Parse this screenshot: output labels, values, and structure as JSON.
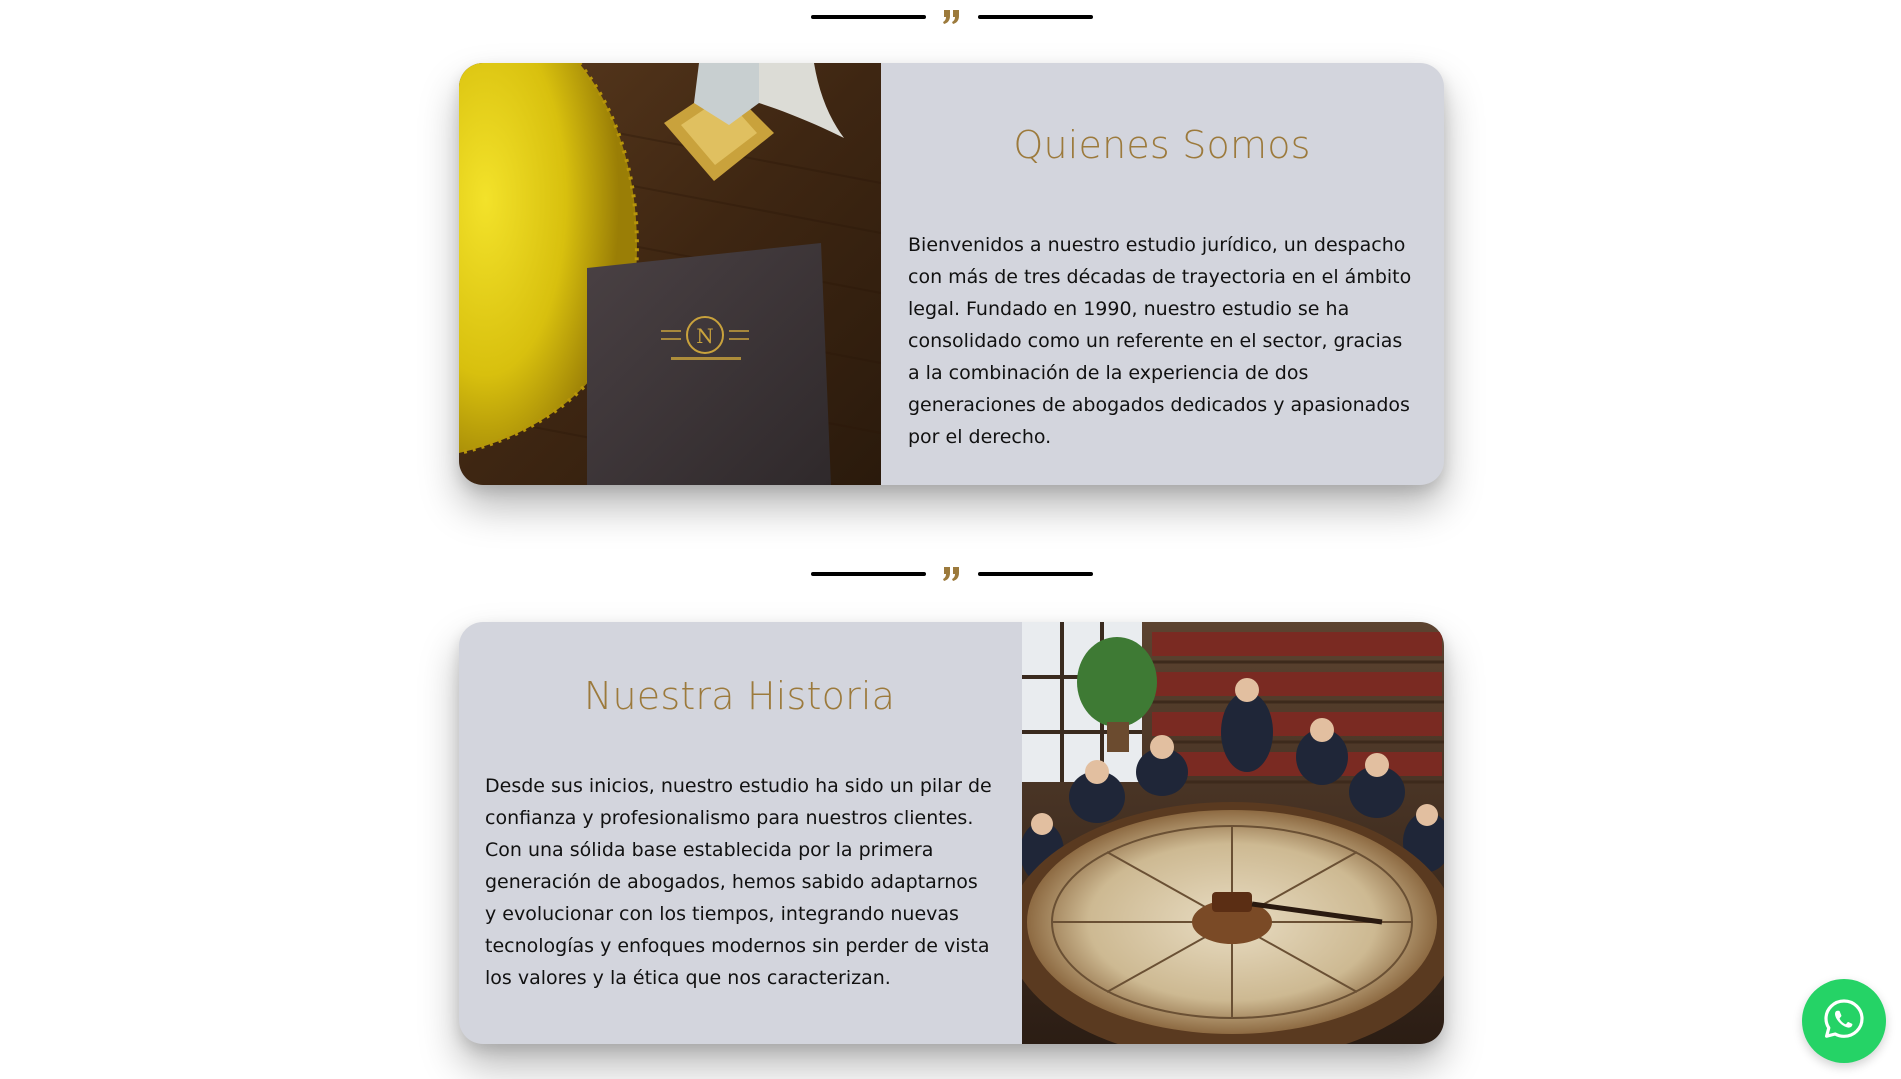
{
  "dividers": [
    {
      "icon": "quote-icon"
    },
    {
      "icon": "quote-icon"
    }
  ],
  "sections": [
    {
      "title": "Quienes Somos",
      "body": "Bienvenidos a nuestro estudio jurídico, un despacho con más de tres décadas de trayectoria en el ámbito legal. Fundado en 1990, nuestro estudio se ha consolidado como un referente en el sector, gracias a la combinación de la experiencia de dos generaciones de abogados dedicados y apasionados por el derecho.",
      "image": "law-firm-folder-photo"
    },
    {
      "title": "Nuestra Historia",
      "body": "Desde sus inicios, nuestro estudio ha sido un pilar de confianza y profesionalismo para nuestros clientes. Con una sólida base establecida por la primera generación de abogados, hemos sabido adaptarnos y evolucionar con los tiempos, integrando nuevas tecnologías y enfoques modernos sin perder de vista los valores y la ética que nos caracterizan.",
      "image": "lawyers-meeting-table-photo"
    }
  ],
  "whatsapp": {
    "icon": "whatsapp-icon"
  },
  "colors": {
    "accent": "#9c7a3c",
    "card_background": "#d3d5dd",
    "whatsapp_green": "#25d366",
    "divider": "#000000"
  }
}
